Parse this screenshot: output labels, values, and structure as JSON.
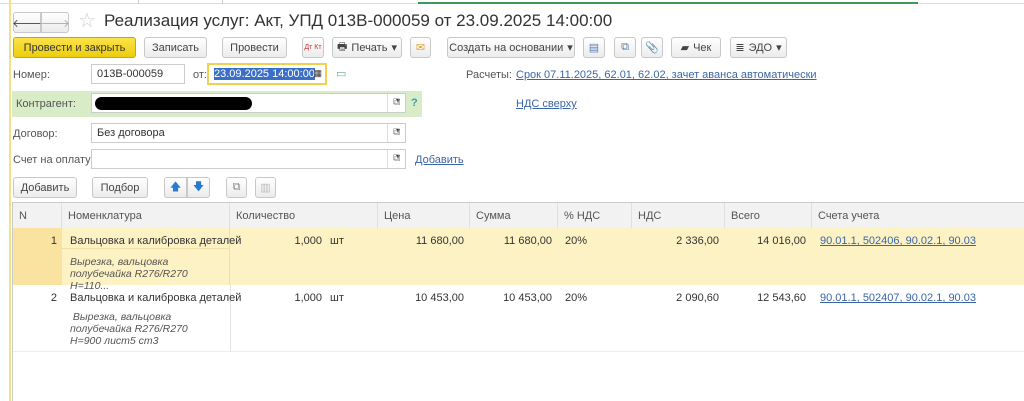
{
  "title": "Реализация услуг: Акт, УПД 013В-000059 от 23.09.2025 14:00:00",
  "toolbar": {
    "post_close": "Провести и закрыть",
    "save": "Записать",
    "post": "Провести",
    "dtkt": "Дт Кт",
    "print": "Печать",
    "create_based": "Создать на основании",
    "check": "Чек",
    "edo": "ЭДО"
  },
  "form": {
    "number_label": "Номер:",
    "number": "013В-000059",
    "date_label": "от:",
    "date": "23.09.2025 14:00:00",
    "settlements_label": "Расчеты:",
    "settlements_link": "Срок 07.11.2025, 62.01, 62.02, зачет аванса автоматически",
    "vat_link": "НДС сверху",
    "counterparty_label": "Контрагент:",
    "counterparty_help": "?",
    "contract_label": "Договор:",
    "contract": "Без договора",
    "invoice_label": "Счет на оплату:",
    "invoice": "",
    "invoice_add": "Добавить"
  },
  "table_toolbar": {
    "add": "Добавить",
    "pick": "Подбор"
  },
  "table": {
    "headers": [
      "N",
      "Номенклатура",
      "Количество",
      "Цена",
      "Сумма",
      "% НДС",
      "НДС",
      "Всего",
      "Счета учета"
    ],
    "rows": [
      {
        "n": "1",
        "name": "Вальцовка и калибровка деталей",
        "desc": "Вырезка, вальцовка полубечайка R276/R270 H=110...",
        "qty": "1,000",
        "unit": "шт",
        "price": "11 680,00",
        "sum": "11 680,00",
        "vat_rate": "20%",
        "vat": "2 336,00",
        "total": "14 016,00",
        "accounts": "90.01.1, 502406, 90.02.1, 90.03"
      },
      {
        "n": "2",
        "name": "Вальцовка и калибровка деталей",
        "desc": " Вырезка, вальцовка полубечайка R276/R270 H=900 лист5 ст3",
        "qty": "1,000",
        "unit": "шт",
        "price": "10 453,00",
        "sum": "10 453,00",
        "vat_rate": "20%",
        "vat": "2 090,60",
        "total": "12 543,60",
        "accounts": "90.01.1, 502407, 90.02.1, 90.03"
      }
    ]
  }
}
